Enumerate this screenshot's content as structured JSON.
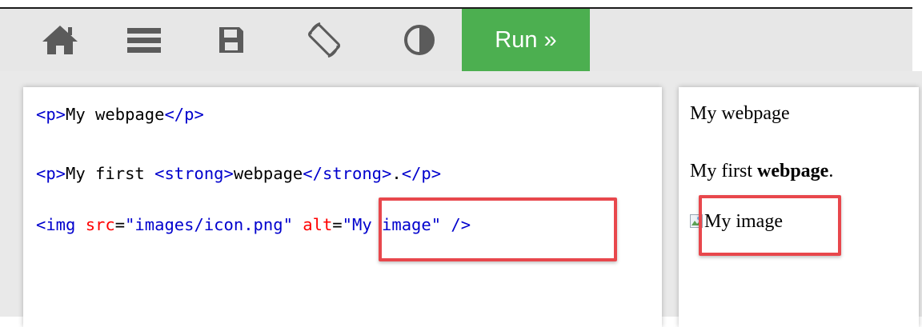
{
  "toolbar": {
    "icons": [
      "home-icon",
      "menu-icon",
      "save-icon",
      "rotate-icon",
      "contrast-icon"
    ],
    "run_label": "Run »",
    "run_color": "#4caf50"
  },
  "code": {
    "line1": {
      "open": "<p>",
      "text": "My webpage",
      "close": "</p>"
    },
    "line2": {
      "open": "<p>",
      "text": "My first ",
      "strong_open": "<strong>",
      "strong_text": "webpage",
      "strong_close": "</strong>",
      "after": ".",
      "close": "</p>"
    },
    "line3": {
      "open": "<img ",
      "src_attr": "src",
      "eq1": "=",
      "src_val": "\"images/icon.png\"",
      "space": " ",
      "alt_attr": "alt",
      "eq2": "=",
      "alt_val": "\"My image\"",
      "close": " />"
    }
  },
  "preview": {
    "line1": "My webpage",
    "line2_prefix": "My first ",
    "line2_bold": "webpage",
    "line2_suffix": ".",
    "img_alt": "My image"
  },
  "highlight_color": "#e8474c"
}
